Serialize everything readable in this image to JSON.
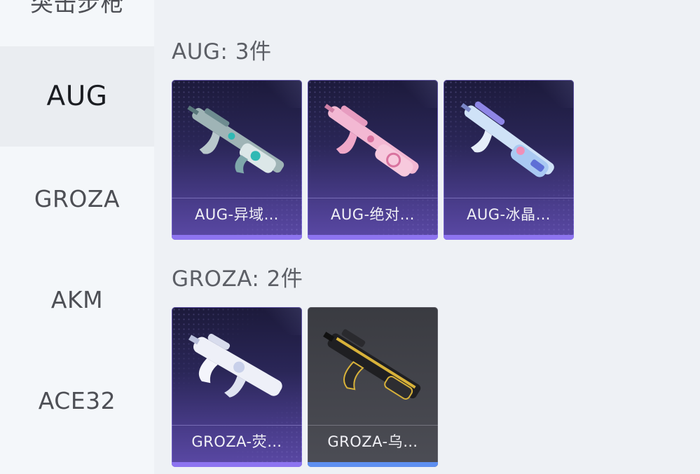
{
  "sidebar": {
    "items": [
      {
        "label": "突击步枪"
      },
      {
        "label": "AUG"
      },
      {
        "label": "GROZA"
      },
      {
        "label": "AKM"
      },
      {
        "label": "ACE32"
      }
    ]
  },
  "sections": [
    {
      "title": "AUG: 3件",
      "cards": [
        {
          "name": "AUG-异域…",
          "rarity": "purple",
          "icon": "aug-rifle-teal-skin"
        },
        {
          "name": "AUG-绝对…",
          "rarity": "purple",
          "icon": "aug-rifle-pink-skin"
        },
        {
          "name": "AUG-冰晶…",
          "rarity": "purple",
          "icon": "aug-rifle-ice-skin"
        }
      ]
    },
    {
      "title": "GROZA: 2件",
      "cards": [
        {
          "name": "GROZA-荧…",
          "rarity": "purple",
          "icon": "groza-rifle-white-skin"
        },
        {
          "name": "GROZA-乌…",
          "rarity": "blue",
          "icon": "groza-rifle-black-gold-skin"
        }
      ]
    }
  ],
  "colors": {
    "purple_rarity": "#8d74f0",
    "blue_rarity": "#5e8ff0",
    "sidebar_bg": "#f4f7fa",
    "active_bg": "#eaedf1"
  }
}
